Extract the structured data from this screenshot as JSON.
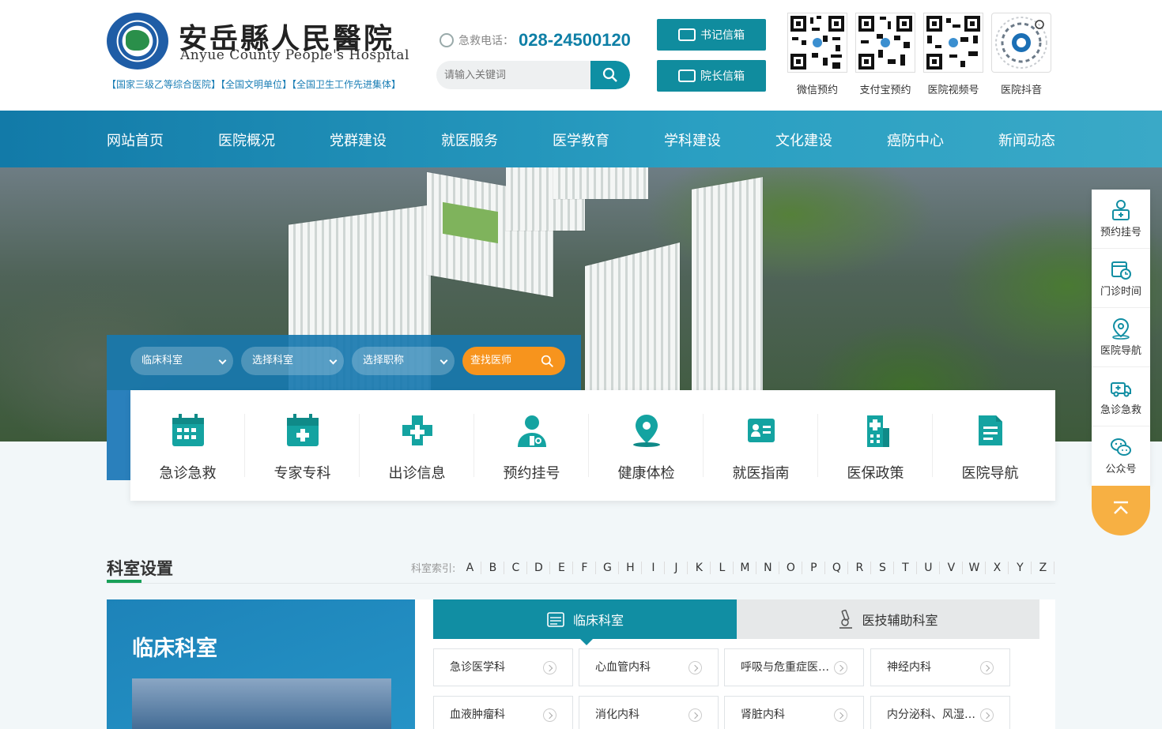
{
  "header": {
    "logo_cn": "安岳縣人民醫院",
    "logo_en": "Anyue County People's Hospital",
    "tags": "【国家三级乙等综合医院】【全国文明单位】【全国卫生工作先进集体】",
    "hotline_label": "急救电话：",
    "hotline_number": "028-24500120",
    "search_placeholder": "请输入关键词",
    "mail_buttons": [
      "书记信箱",
      "院长信箱"
    ],
    "qr_codes": [
      "微信预约",
      "支付宝预约",
      "医院视频号",
      "医院抖音"
    ]
  },
  "nav": {
    "items": [
      "网站首页",
      "医院概况",
      "党群建设",
      "就医服务",
      "医学教育",
      "学科建设",
      "文化建设",
      "癌防中心",
      "新闻动态"
    ]
  },
  "finder": {
    "selects": [
      "临床科室",
      "选择科室",
      "选择职称"
    ],
    "search_label": "查找医师"
  },
  "services": [
    {
      "label": "急诊急救",
      "icon": "calendar-grid-icon"
    },
    {
      "label": "专家专科",
      "icon": "medical-calendar-icon"
    },
    {
      "label": "出诊信息",
      "icon": "medical-cross-icon"
    },
    {
      "label": "预约挂号",
      "icon": "doctor-icon"
    },
    {
      "label": "健康体检",
      "icon": "location-pin-icon"
    },
    {
      "label": "就医指南",
      "icon": "id-card-icon"
    },
    {
      "label": "医保政策",
      "icon": "hospital-building-icon"
    },
    {
      "label": "医院导航",
      "icon": "document-icon"
    }
  ],
  "sidebar": {
    "items": [
      "预约挂号",
      "门诊时间",
      "医院导航",
      "急诊急救",
      "公众号"
    ],
    "to_top_icon": "chevron-up-icon"
  },
  "departments": {
    "title": "科室设置",
    "index_label": "科室索引:",
    "letters": [
      "A",
      "B",
      "C",
      "D",
      "E",
      "F",
      "G",
      "H",
      "I",
      "J",
      "K",
      "L",
      "M",
      "N",
      "O",
      "P",
      "Q",
      "R",
      "S",
      "T",
      "U",
      "V",
      "W",
      "X",
      "Y",
      "Z"
    ],
    "banner_title": "临床科室",
    "tabs": [
      "临床科室",
      "医技辅助科室"
    ],
    "list": [
      "急诊医学科",
      "心血管内科",
      "呼吸与危重症医…",
      "神经内科",
      "血液肿瘤科",
      "消化内科",
      "肾脏内科",
      "内分泌科、风湿…"
    ]
  },
  "colors": {
    "teal": "#118ea3",
    "nav_blue": "#127aa8",
    "orange": "#f7941d",
    "green_accent": "#18a058",
    "hotline": "#0e7fa6"
  }
}
